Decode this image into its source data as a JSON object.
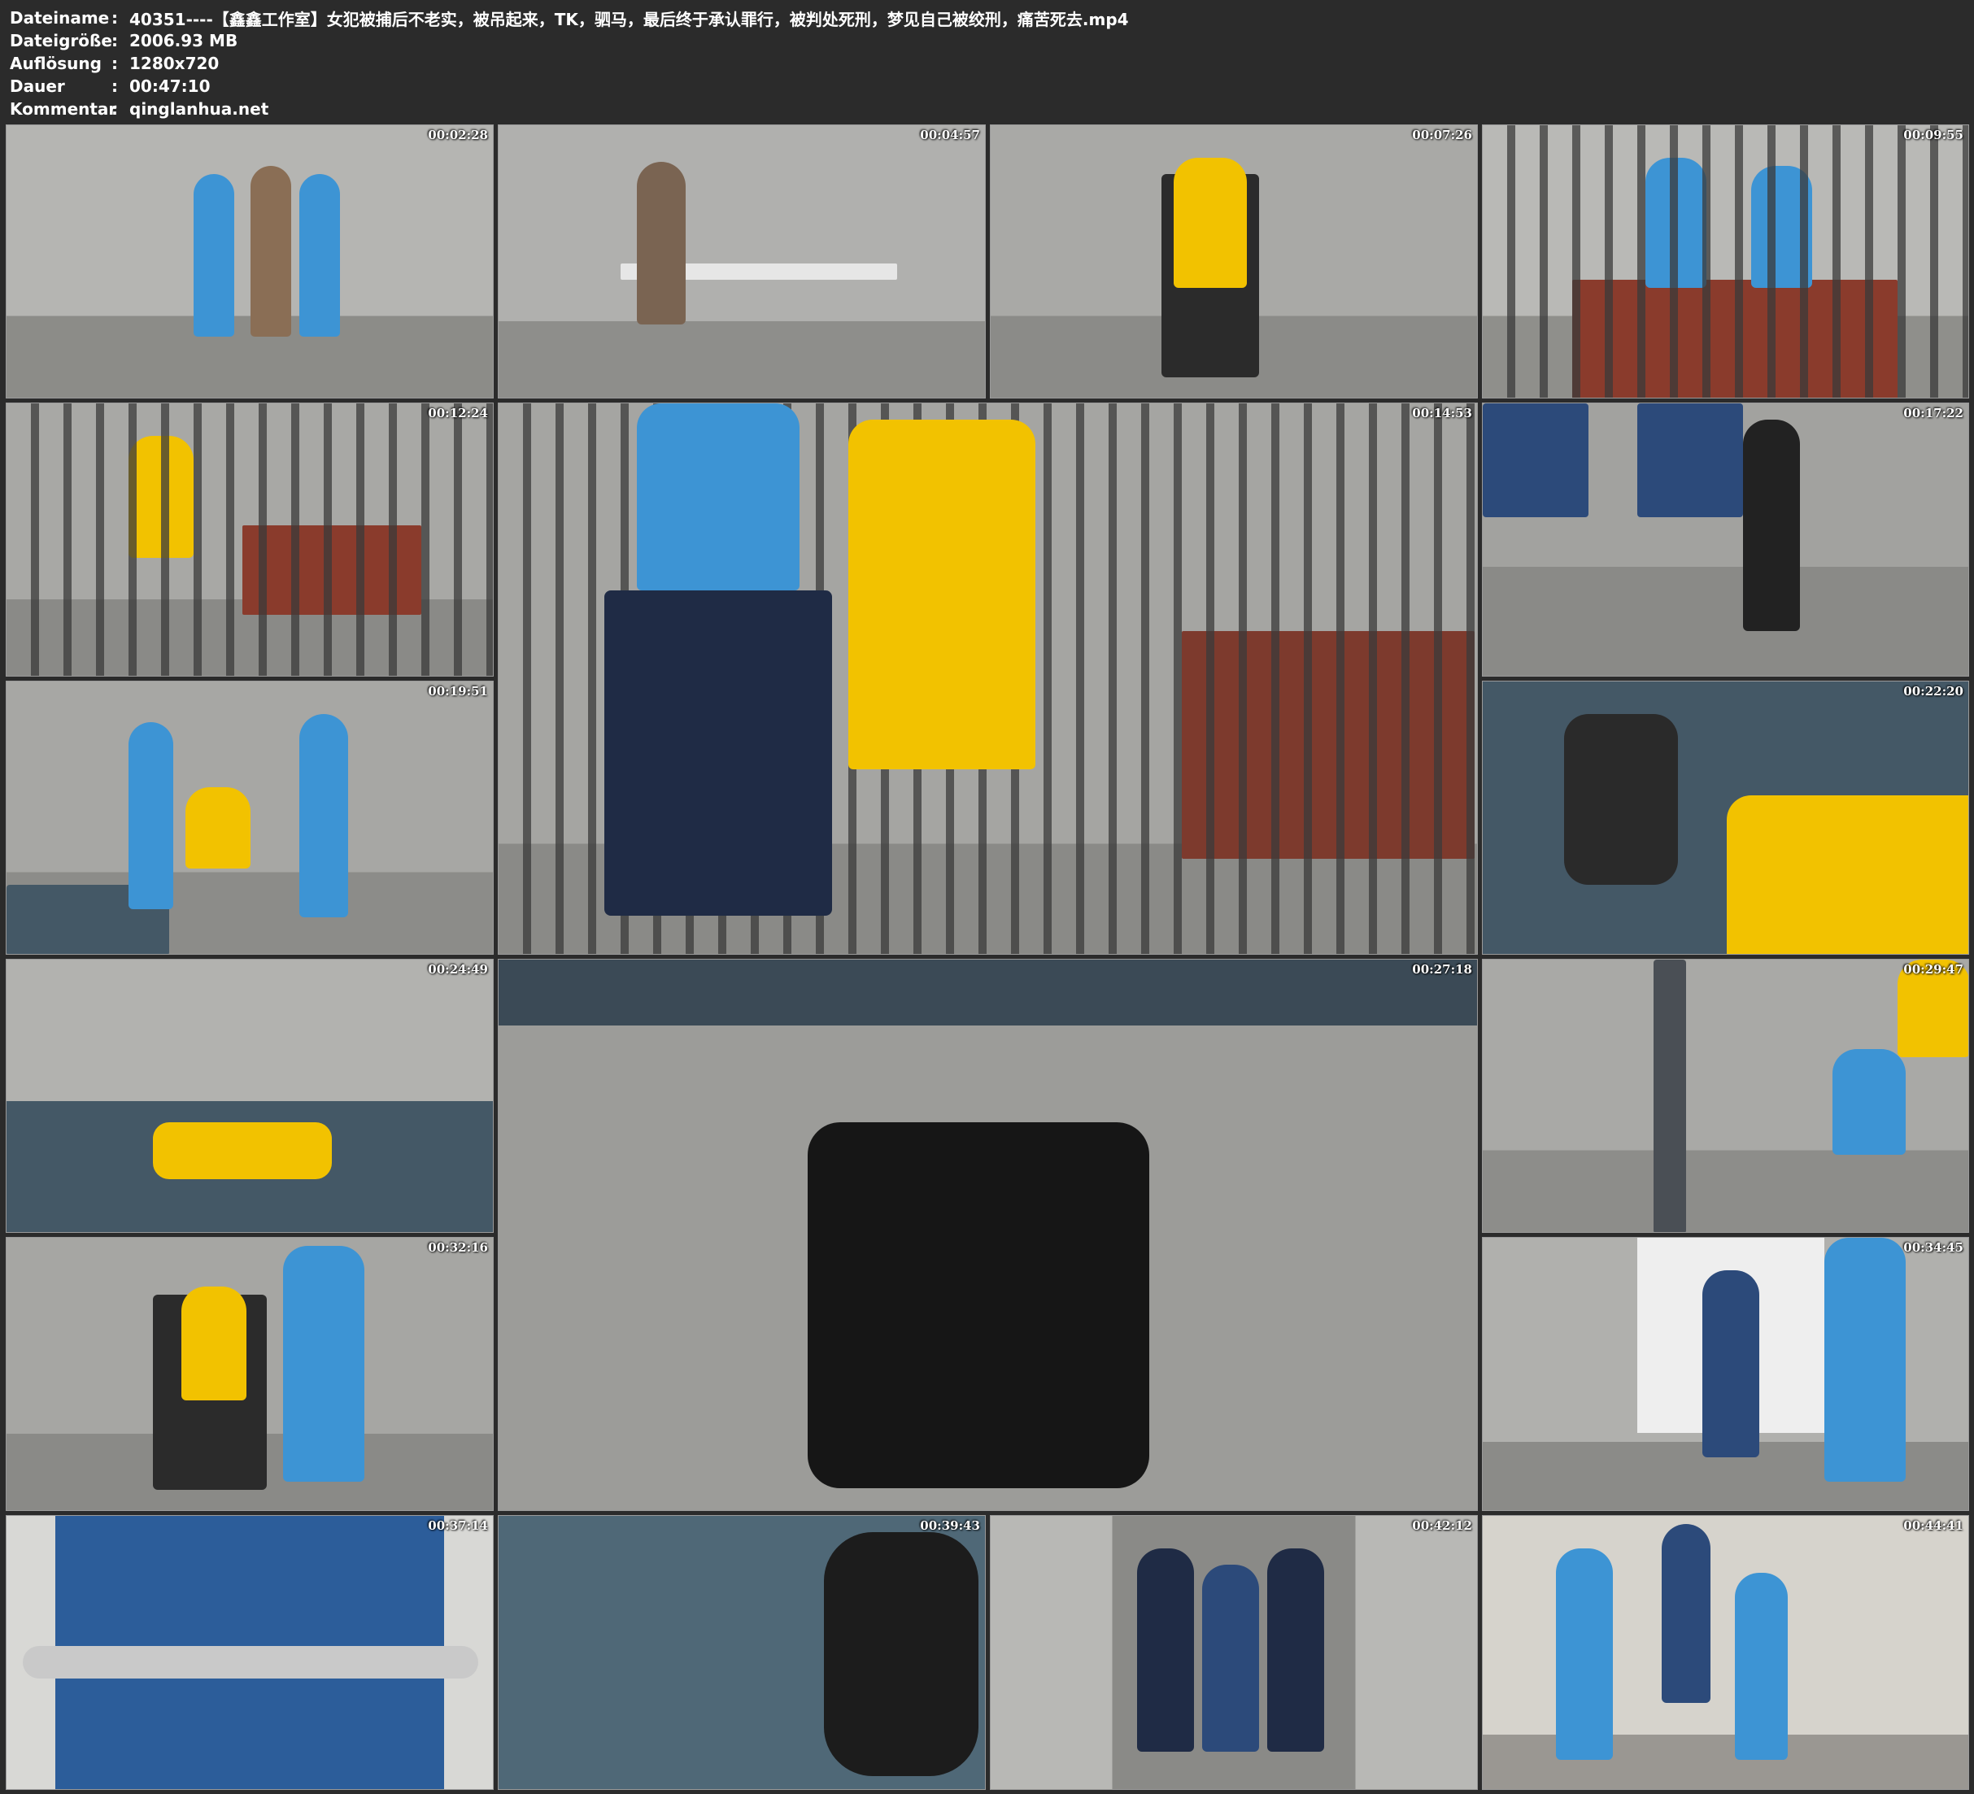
{
  "header": {
    "rows": [
      {
        "key": "Dateiname",
        "sep": ":",
        "value": "40351----【鑫鑫工作室】女犯被捕后不老实，被吊起来，TK，驷马，最后终于承认罪行，被判处死刑，梦见自己被绞刑，痛苦死去.mp4"
      },
      {
        "key": "Dateigröße",
        "sep": ":",
        "value": "2006.93 MB"
      },
      {
        "key": "Auflösung",
        "sep": ":",
        "value": "1280x720"
      },
      {
        "key": "Dauer",
        "sep": ":",
        "value": "00:47:10"
      },
      {
        "key": "Kommentar",
        "sep": ":",
        "value": "qinglanhua.net"
      }
    ]
  },
  "thumbnails": [
    {
      "timestamp": "00:02:28"
    },
    {
      "timestamp": "00:04:57"
    },
    {
      "timestamp": "00:07:26"
    },
    {
      "timestamp": "00:09:55"
    },
    {
      "timestamp": "00:12:24"
    },
    {
      "timestamp": "00:14:53"
    },
    {
      "timestamp": "00:17:22"
    },
    {
      "timestamp": "00:19:51"
    },
    {
      "timestamp": "00:22:20"
    },
    {
      "timestamp": "00:24:49"
    },
    {
      "timestamp": "00:27:18"
    },
    {
      "timestamp": "00:29:47"
    },
    {
      "timestamp": "00:32:16"
    },
    {
      "timestamp": "00:34:45"
    },
    {
      "timestamp": "00:37:14"
    },
    {
      "timestamp": "00:39:43"
    },
    {
      "timestamp": "00:42:12"
    },
    {
      "timestamp": "00:44:41"
    }
  ],
  "colors": {
    "background": "#2b2b2b",
    "wall_gray": "#a9a9a7",
    "floor_gray": "#8d8d8b",
    "uniform_blue": "#3d94d4",
    "skirt_navy": "#1f2b45",
    "prison_yellow": "#f2c200",
    "mattress_blue": "#445866"
  }
}
